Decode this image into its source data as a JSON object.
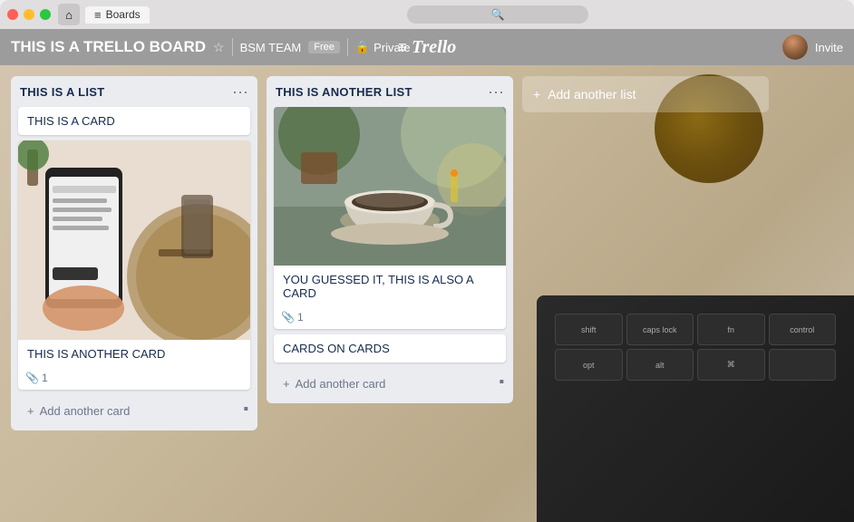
{
  "window": {
    "traffic_lights": {
      "red": "red",
      "yellow": "yellow",
      "green": "green"
    },
    "tab_label": "Boards",
    "search_placeholder": "Search"
  },
  "topbar": {
    "logo": "Trello",
    "board_title": "THIS IS A TRELLO BOARD",
    "team": "BSM TEAM",
    "free_label": "Free",
    "privacy": "Private",
    "invite_label": "Invite"
  },
  "lists": [
    {
      "id": "list1",
      "title": "THIS IS A LIST",
      "cards": [
        {
          "id": "card1",
          "text": "THIS IS A CARD",
          "has_image": false,
          "attachments": 0
        },
        {
          "id": "card2",
          "text": "THIS IS ANOTHER CARD",
          "has_image": true,
          "image_type": "phone",
          "attachments": 1
        }
      ],
      "add_card_label": "Add another card"
    },
    {
      "id": "list2",
      "title": "THIS IS ANOTHER LIST",
      "cards": [
        {
          "id": "card3",
          "text": "YOU GUESSED IT, THIS IS ALSO A CARD",
          "has_image": true,
          "image_type": "coffee",
          "attachments": 1
        },
        {
          "id": "card4",
          "text": "CARDS ON CARDS",
          "has_image": false,
          "attachments": 0
        }
      ],
      "add_card_label": "Add another card"
    }
  ],
  "add_list_label": "Add another list",
  "icons": {
    "star": "☆",
    "lock": "🔒",
    "paperclip": "📎",
    "plus": "+",
    "ellipsis": "···",
    "search": "🔍",
    "home": "⌂",
    "card_template": "▪",
    "trello_logo": "≡"
  },
  "colors": {
    "topbar_bg": "rgba(0,0,0,0.35)",
    "list_bg": "#ebecf0",
    "card_bg": "#ffffff",
    "text_primary": "#172b4d",
    "text_secondary": "#6b778c"
  }
}
